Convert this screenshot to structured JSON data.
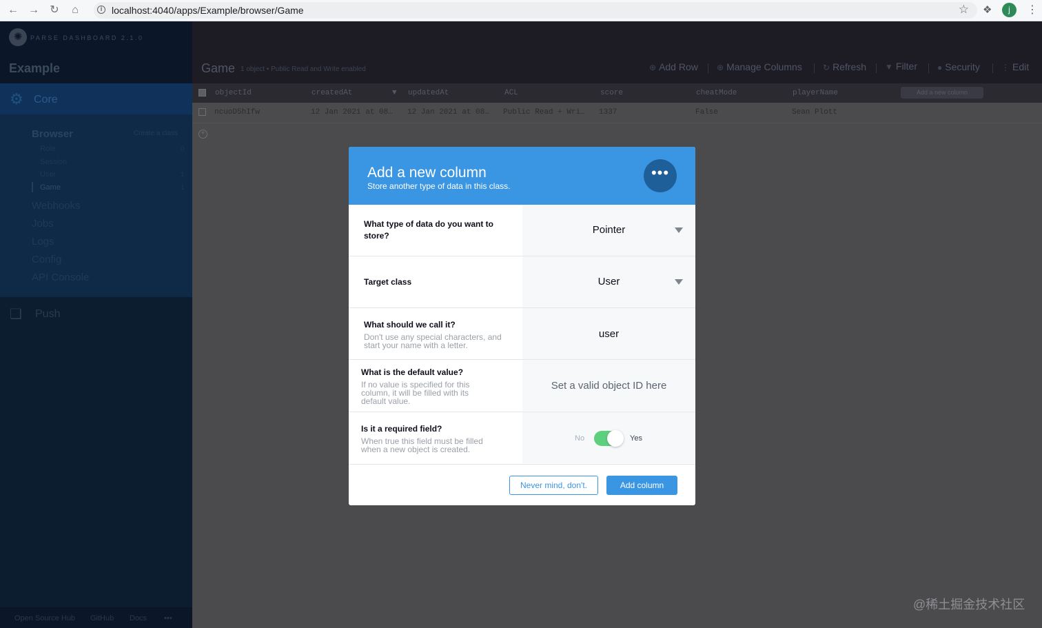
{
  "browser": {
    "url": "localhost:4040/apps/Example/browser/Game",
    "profile_initial": "j"
  },
  "sidebar": {
    "brand": "PARSE DASHBOARD 2.1.0",
    "app_name": "Example",
    "core_label": "Core",
    "browser_label": "Browser",
    "create_class": "Create a class",
    "classes": [
      {
        "name": "Role",
        "count": "0"
      },
      {
        "name": "Session",
        "count": ""
      },
      {
        "name": "User",
        "count": "1"
      },
      {
        "name": "Game",
        "count": "1"
      }
    ],
    "links": [
      "Webhooks",
      "Jobs",
      "Logs",
      "Config",
      "API Console"
    ],
    "push_label": "Push",
    "footer": [
      "Open Source Hub",
      "GitHub",
      "Docs",
      "•••"
    ]
  },
  "toolbar": {
    "title": "Game",
    "subtitle": "1 object • Public Read and Write enabled",
    "actions": [
      "Add Row",
      "Manage Columns",
      "Refresh",
      "Filter",
      "Security",
      "Edit"
    ]
  },
  "table": {
    "columns": [
      "objectId",
      "createdAt",
      "updatedAt",
      "ACL",
      "score",
      "cheatMode",
      "playerName"
    ],
    "add_column_button": "Add a new column",
    "rows": [
      [
        "ncuoD5hIfw",
        "12 Jan 2021 at 08…",
        "12 Jan 2021 at 08…",
        "Public Read + Wri…",
        "1337",
        "False",
        "Sean Plott"
      ]
    ]
  },
  "modal": {
    "title": "Add a new column",
    "subtitle": "Store another type of data in this class.",
    "type_label": "What type of data do you want to store?",
    "type_value": "Pointer",
    "target_label": "Target class",
    "target_value": "User",
    "name_label": "What should we call it?",
    "name_desc": "Don't use any special characters, and start your name with a letter.",
    "name_value": "user",
    "default_label": "What is the default value?",
    "default_desc": "If no value is specified for this column, it will be filled with its default value.",
    "default_placeholder": "Set a valid object ID here",
    "required_label": "Is it a required field?",
    "required_desc": "When true this field must be filled when a new object is created.",
    "toggle_no": "No",
    "toggle_yes": "Yes",
    "required_value": true,
    "cancel_label": "Never mind, don't.",
    "submit_label": "Add column"
  },
  "watermark": "@稀土掘金技术社区",
  "colors": {
    "accent": "#3a96e2",
    "toggle_on": "#5dd07e",
    "sidebar_bg": "#0d1d30"
  }
}
